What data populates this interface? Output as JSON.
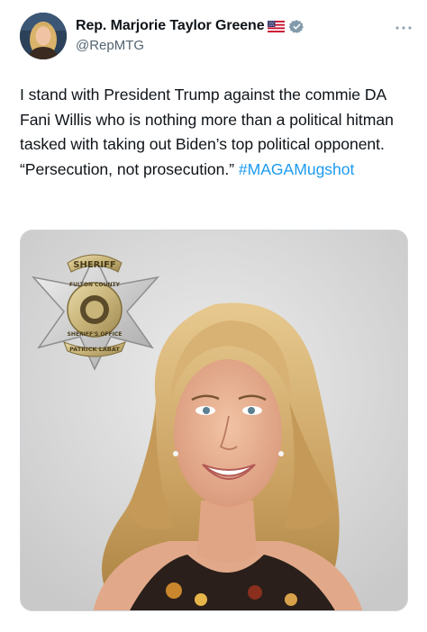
{
  "author": {
    "display_name": "Rep. Marjorie Taylor Greene",
    "handle": "@RepMTG",
    "flag_icon": "us-flag-icon",
    "verified_icon": "gray-verified-badge-icon",
    "verified_color": "#829aab",
    "avatar_icon": "profile-photo"
  },
  "menu": {
    "icon": "more-options-icon"
  },
  "tweet": {
    "text_before_hashtag": "I stand with President Trump against the commie DA Fani Willis who is nothing more than a political hitman tasked with taking out Biden’s top political opponent. “Persecution, not prosecution.” ",
    "hashtag": "#MAGAMugshot",
    "hashtag_color": "#1d9bf0"
  },
  "media": {
    "type": "photo",
    "badge": {
      "top_text": "SHERIFF",
      "county_text": "FULTON COUNTY",
      "office_text": "SHERIFF'S OFFICE",
      "name_text": "PATRICK LABAT"
    }
  }
}
